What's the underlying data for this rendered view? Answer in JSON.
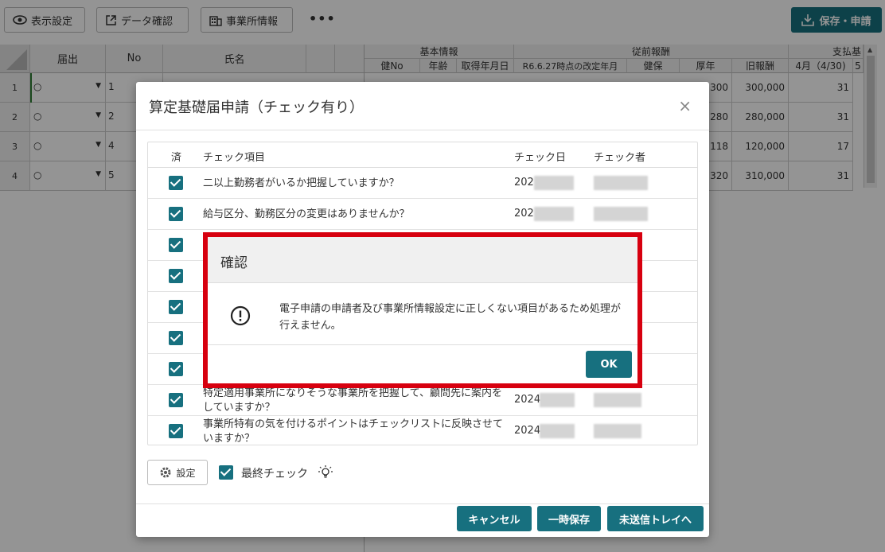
{
  "toolbar": {
    "display_settings": "表示設定",
    "data_check": "データ確認",
    "office_info": "事業所情報",
    "more": "•••",
    "save_apply": "保存・申請"
  },
  "grid": {
    "left_headers": [
      "届出",
      "No",
      "氏名"
    ],
    "rows": [
      {
        "rownum": "1",
        "no": "1"
      },
      {
        "rownum": "2",
        "no": "2"
      },
      {
        "rownum": "3",
        "no": "4"
      },
      {
        "rownum": "4",
        "no": "5"
      }
    ],
    "group_headers": [
      "基本情報",
      "従前報酬",
      "支払基"
    ],
    "sub_headers": [
      "健No",
      "年齢",
      "取得年月日",
      "R6.6.27時点の改定年月",
      "健保",
      "厚年",
      "旧報酬",
      "4月（4/30)",
      "5"
    ],
    "values": [
      {
        "kounen": "300",
        "old": "300,000",
        "april": "31"
      },
      {
        "kounen": "280",
        "old": "280,000",
        "april": "31"
      },
      {
        "kounen": "118",
        "old": "120,000",
        "april": "17"
      },
      {
        "kounen": "320",
        "old": "310,000",
        "april": "31"
      }
    ]
  },
  "modal": {
    "title": "算定基礎届申請（チェック有り）",
    "close": "×",
    "headers": {
      "done": "済",
      "item": "チェック項目",
      "date": "チェック日",
      "checker": "チェック者"
    },
    "rows": [
      {
        "text": "二以上勤務者がいるか把握していますか？",
        "date": "202"
      },
      {
        "text": "給与区分、勤務区分の変更はありませんか？",
        "date": "202"
      },
      {
        "text": "",
        "date": ""
      },
      {
        "text": "",
        "date": ""
      },
      {
        "text": "",
        "date": ""
      },
      {
        "text": "",
        "date": ""
      },
      {
        "text": "",
        "date": ""
      },
      {
        "text": "特定適用事業所になりそうな事業所を把握して、顧問先に案内をしていますか？",
        "date": "2024"
      },
      {
        "text": "事業所特有の気を付けるポイントはチェックリストに反映させていますか？",
        "date": "2024"
      }
    ],
    "settings_label": "設定",
    "final_check_label": "最終チェック",
    "cancel": "キャンセル",
    "temp_save": "一時保存",
    "unsent_tray": "未送信トレイへ"
  },
  "confirm": {
    "title": "確認",
    "message": "電子申請の申請者及び事業所情報設定に正しくない項目があるため処理が行えません。",
    "ok": "OK"
  },
  "colors": {
    "accent": "#17707f",
    "highlight": "#d7000f"
  }
}
